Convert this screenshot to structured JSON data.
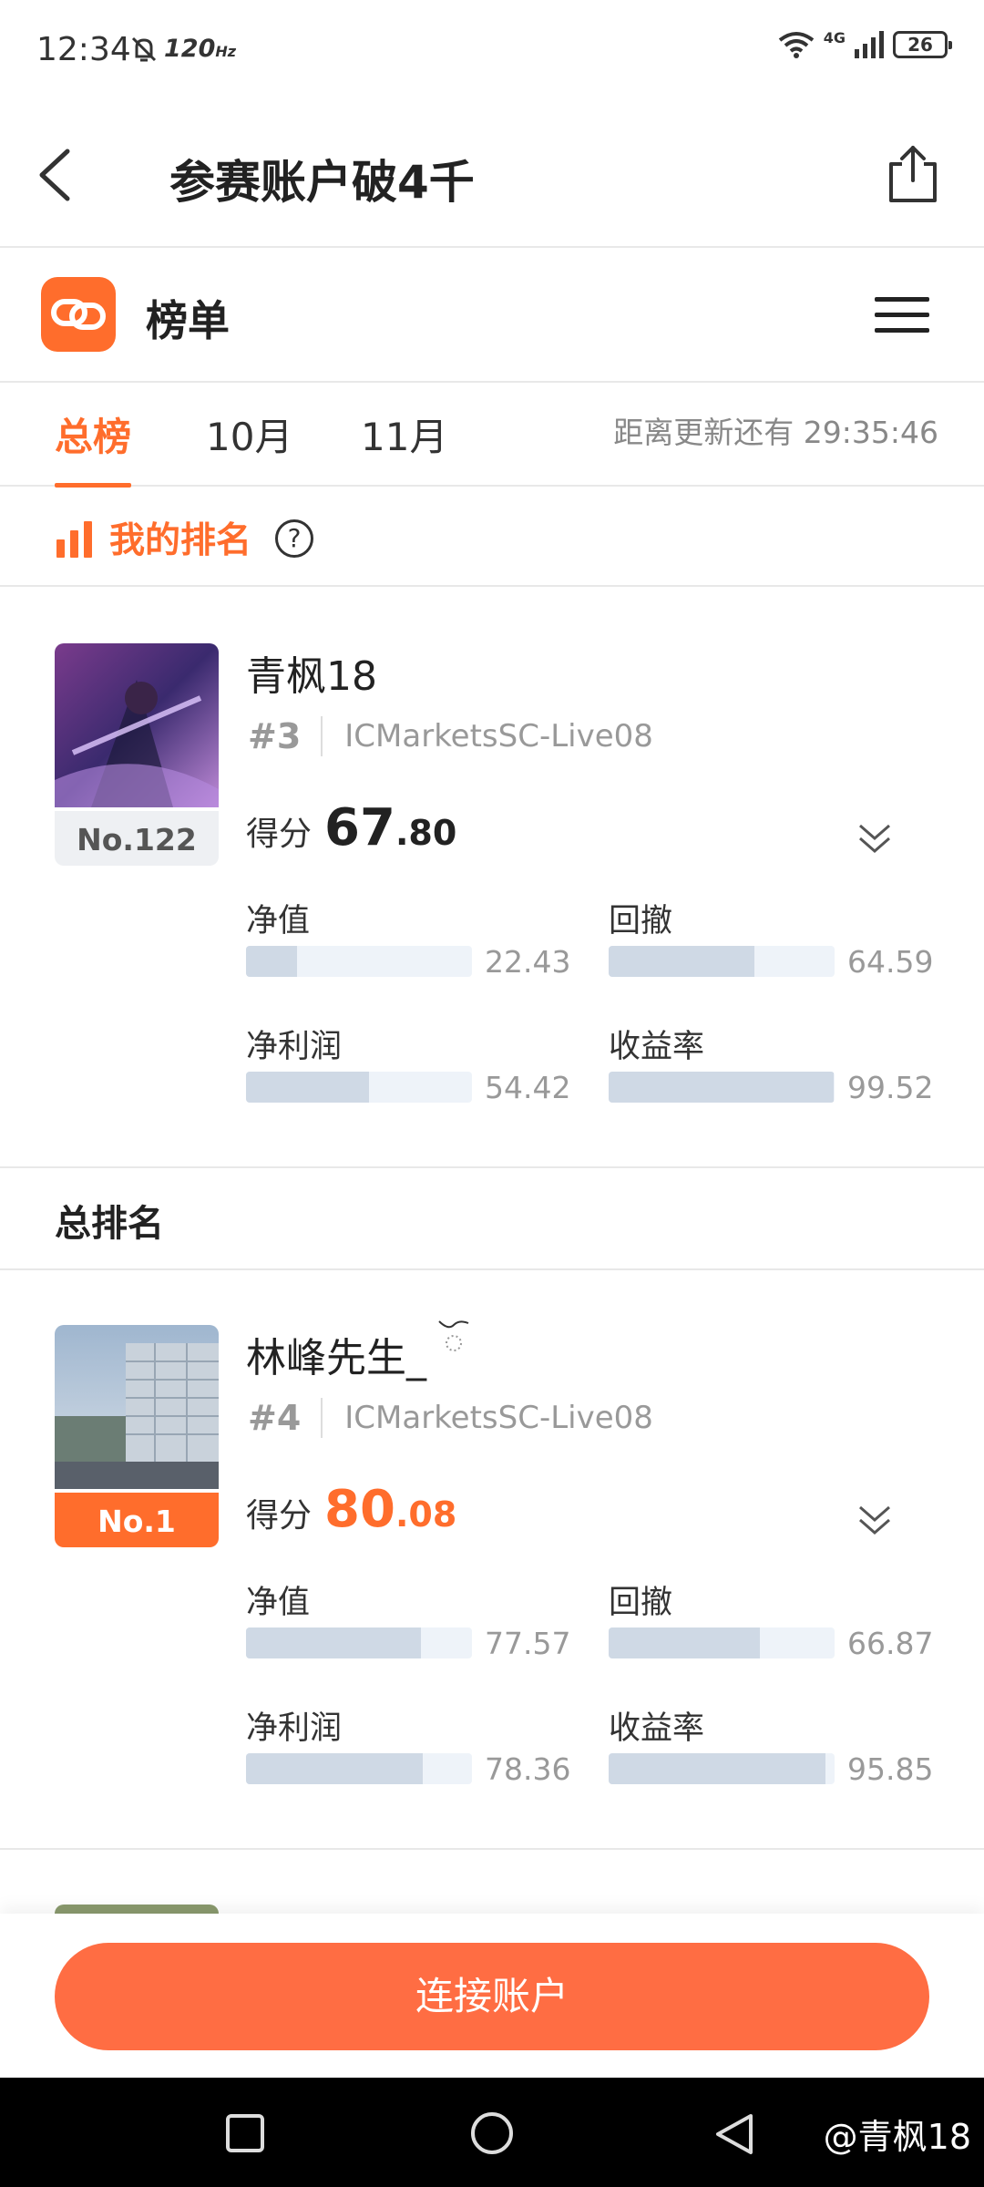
{
  "status_bar": {
    "time": "12:34",
    "refresh_rate": "120",
    "refresh_unit": "Hz",
    "network": "4G",
    "battery": "26"
  },
  "nav": {
    "title": "参赛账户破4千"
  },
  "header": {
    "title": "榜单"
  },
  "tabs": [
    {
      "label": "总榜",
      "active": true
    },
    {
      "label": "10月",
      "active": false
    },
    {
      "label": "11月",
      "active": false
    }
  ],
  "countdown": "距离更新还有 29:35:46",
  "my_rank": {
    "label": "我的排名",
    "help": "?"
  },
  "my_card": {
    "name": "青枫18",
    "rank": "No.122",
    "account_number": "#3",
    "account_name": "ICMarketsSC-Live08",
    "score_label": "得分",
    "score_int": "67",
    "score_dec": ".80",
    "metrics": [
      {
        "label": "净值",
        "value": "22.43",
        "fill": 22.43
      },
      {
        "label": "回撤",
        "value": "64.59",
        "fill": 64.59
      },
      {
        "label": "净利润",
        "value": "54.42",
        "fill": 54.42
      },
      {
        "label": "收益率",
        "value": "99.52",
        "fill": 99.52
      }
    ]
  },
  "overall_section": {
    "title": "总排名"
  },
  "first_card": {
    "name": "林峰先生_",
    "rank": "No.1",
    "account_number": "#4",
    "account_name": "ICMarketsSC-Live08",
    "score_label": "得分",
    "score_int": "80",
    "score_dec": ".08",
    "metrics": [
      {
        "label": "净值",
        "value": "77.57",
        "fill": 77.57
      },
      {
        "label": "回撤",
        "value": "66.87",
        "fill": 66.87
      },
      {
        "label": "净利润",
        "value": "78.36",
        "fill": 78.36
      },
      {
        "label": "收益率",
        "value": "95.85",
        "fill": 95.85
      }
    ]
  },
  "bottom": {
    "connect_label": "连接账户"
  },
  "watermark": "@青枫18",
  "colors": {
    "accent": "#ff6d2c",
    "bar_track": "#eef3f9",
    "bar_fill": "#cfd9e5"
  }
}
